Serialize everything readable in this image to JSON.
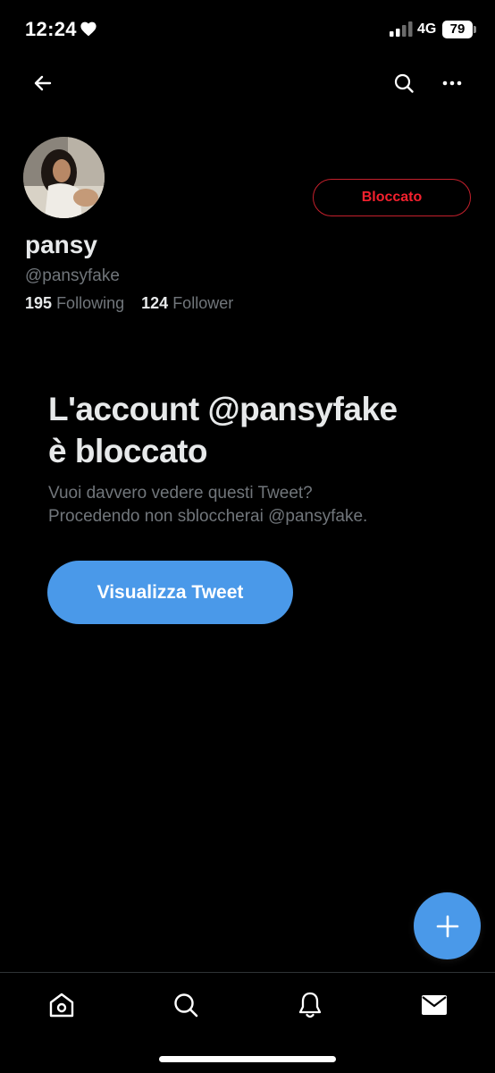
{
  "status_bar": {
    "time": "12:24",
    "network": "4G",
    "battery": "79"
  },
  "profile": {
    "display_name": "pansy",
    "handle": "@pansyfake",
    "blocked_button_label": "Bloccato",
    "following_count": "195",
    "following_label": "Following",
    "followers_count": "124",
    "followers_label": "Follower"
  },
  "blocked_notice": {
    "title_line1": "L'account @pansyfake",
    "title_line2": "è bloccato",
    "desc_line1": "Vuoi davvero vedere questi Tweet?",
    "desc_line2": "Procedendo non sbloccherai @pansyfake.",
    "button_label": "Visualizza Tweet"
  },
  "colors": {
    "background": "#000000",
    "accent": "#4a99e9",
    "blocked_red": "#f4212e",
    "secondary_text": "#71767b"
  },
  "icons": {
    "nav": [
      "back-arrow-icon",
      "search-icon",
      "more-icon"
    ],
    "tabs": [
      "home-icon",
      "search-icon",
      "bell-icon",
      "envelope-icon"
    ],
    "fab": "plus-icon"
  }
}
